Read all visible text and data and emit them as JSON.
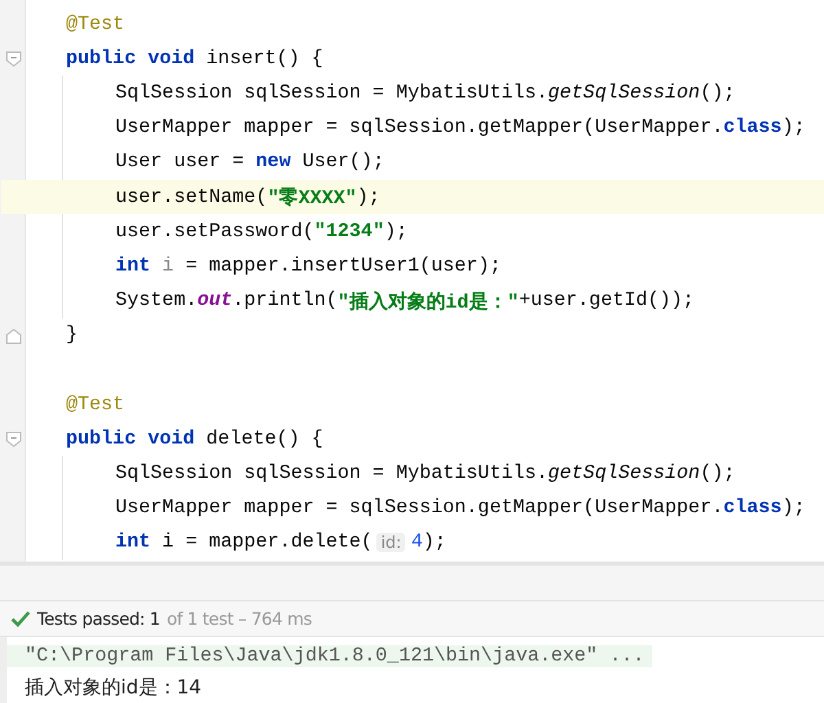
{
  "editor": {
    "methods": [
      {
        "annotation": "@Test",
        "header": [
          {
            "t": "public void ",
            "kind": "keyword"
          },
          {
            "t": "insert() {",
            "kind": "plain"
          }
        ],
        "body": [
          {
            "highlighted": false,
            "tokens": [
              {
                "t": "SqlSession sqlSession = MybatisUtils.",
                "kind": "plain"
              },
              {
                "t": "getSqlSession",
                "kind": "italic"
              },
              {
                "t": "();",
                "kind": "plain"
              }
            ]
          },
          {
            "highlighted": false,
            "tokens": [
              {
                "t": "UserMapper mapper = sqlSession.getMapper(UserMapper.",
                "kind": "plain"
              },
              {
                "t": "class",
                "kind": "keyword"
              },
              {
                "t": ");",
                "kind": "plain"
              }
            ]
          },
          {
            "highlighted": false,
            "tokens": [
              {
                "t": "User user = ",
                "kind": "plain"
              },
              {
                "t": "new",
                "kind": "keyword"
              },
              {
                "t": " User();",
                "kind": "plain"
              }
            ]
          },
          {
            "highlighted": true,
            "tokens": [
              {
                "t": "user.setName(",
                "kind": "plain"
              },
              {
                "t": "\"零XXXX\"",
                "kind": "string"
              },
              {
                "t": ");",
                "kind": "plain"
              }
            ]
          },
          {
            "highlighted": false,
            "tokens": [
              {
                "t": "user.setPassword(",
                "kind": "plain"
              },
              {
                "t": "\"1234\"",
                "kind": "string"
              },
              {
                "t": ");",
                "kind": "plain"
              }
            ]
          },
          {
            "highlighted": false,
            "tokens": [
              {
                "t": "int",
                "kind": "keyword"
              },
              {
                "t": " i",
                "kind": "unused"
              },
              {
                "t": " = mapper.insertUser1(user);",
                "kind": "plain"
              }
            ]
          },
          {
            "highlighted": false,
            "tokens": [
              {
                "t": "System.",
                "kind": "plain"
              },
              {
                "t": "out",
                "kind": "static"
              },
              {
                "t": ".println(",
                "kind": "plain"
              },
              {
                "t": "\"插入对象的id是：\"",
                "kind": "string"
              },
              {
                "t": "+user.getId());",
                "kind": "plain"
              }
            ]
          }
        ],
        "closing": "}"
      },
      {
        "annotation": "@Test",
        "header": [
          {
            "t": "public void ",
            "kind": "keyword"
          },
          {
            "t": "delete() {",
            "kind": "plain"
          }
        ],
        "body": [
          {
            "highlighted": false,
            "tokens": [
              {
                "t": "SqlSession sqlSession = MybatisUtils.",
                "kind": "plain"
              },
              {
                "t": "getSqlSession",
                "kind": "italic"
              },
              {
                "t": "();",
                "kind": "plain"
              }
            ]
          },
          {
            "highlighted": false,
            "tokens": [
              {
                "t": "UserMapper mapper = sqlSession.getMapper(UserMapper.",
                "kind": "plain"
              },
              {
                "t": "class",
                "kind": "keyword"
              },
              {
                "t": ");",
                "kind": "plain"
              }
            ]
          },
          {
            "highlighted": false,
            "tokens": [
              {
                "t": "int",
                "kind": "keyword"
              },
              {
                "t": " i = mapper.delete(",
                "kind": "plain"
              },
              {
                "t": "id:",
                "kind": "hint"
              },
              {
                "t": "4",
                "kind": "number"
              },
              {
                "t": ");",
                "kind": "plain"
              }
            ]
          }
        ]
      }
    ]
  },
  "test_status": {
    "passed": true,
    "summary": "Tests passed: 1",
    "detail": "of 1 test – 764 ms"
  },
  "console": {
    "lines": [
      {
        "kind": "command",
        "text": "\"C:\\Program Files\\Java\\jdk1.8.0_121\\bin\\java.exe\" ..."
      },
      {
        "kind": "output",
        "text": "插入对象的id是：14"
      }
    ]
  }
}
